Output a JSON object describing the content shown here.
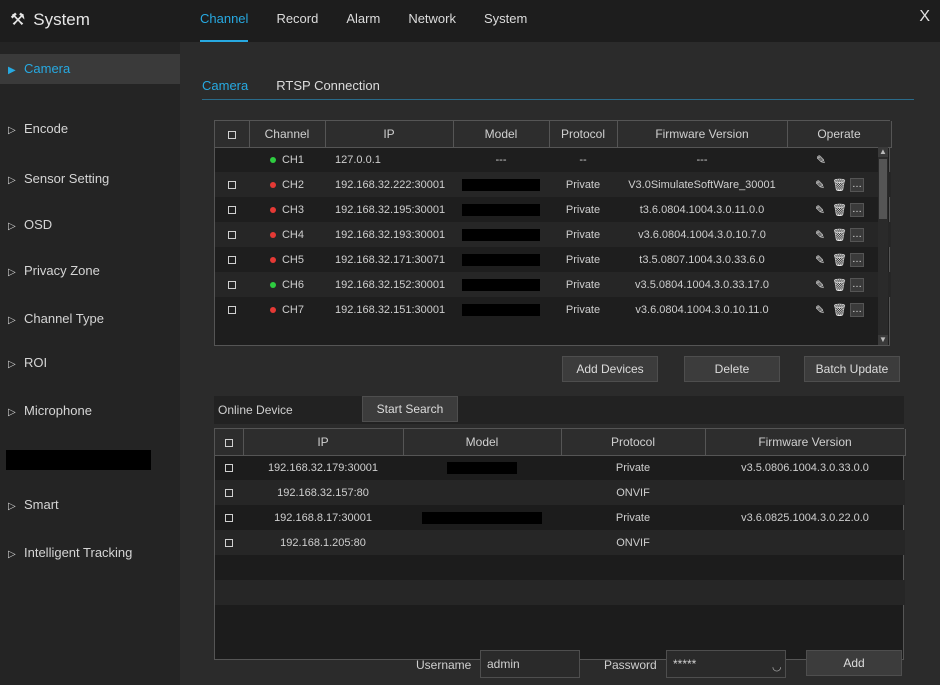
{
  "header": {
    "title": "System",
    "tool_icon": "tools-icon",
    "tabs": [
      "Channel",
      "Record",
      "Alarm",
      "Network",
      "System"
    ],
    "active_tab": "Channel",
    "close_glyph": "X"
  },
  "sidebar": {
    "items": [
      {
        "label": "Camera",
        "active": true
      },
      {
        "label": "Encode"
      },
      {
        "label": "Sensor Setting"
      },
      {
        "label": "OSD"
      },
      {
        "label": "Privacy Zone"
      },
      {
        "label": "Channel Type"
      },
      {
        "label": "ROI"
      },
      {
        "label": "Microphone"
      },
      {
        "label": "Smart"
      },
      {
        "label": "Intelligent Tracking"
      }
    ]
  },
  "subtabs": [
    "Camera",
    "RTSP Connection"
  ],
  "camera_table": {
    "headers": [
      "Channel",
      "IP",
      "Model",
      "Protocol",
      "Firmware Version",
      "Operate"
    ],
    "rows": [
      {
        "channel": "CH1",
        "status": "green",
        "ip": "127.0.0.1",
        "model": "---",
        "protocol": "--",
        "firmware": "---",
        "checkbox": false,
        "redacted": false
      },
      {
        "channel": "CH2",
        "status": "red",
        "ip": "192.168.32.222:30001",
        "model": "",
        "protocol": "Private",
        "firmware": "V3.0SimulateSoftWare_30001",
        "checkbox": true,
        "redacted": true
      },
      {
        "channel": "CH3",
        "status": "red",
        "ip": "192.168.32.195:30001",
        "model": "",
        "protocol": "Private",
        "firmware": "t3.6.0804.1004.3.0.11.0.0",
        "checkbox": true,
        "redacted": true
      },
      {
        "channel": "CH4",
        "status": "red",
        "ip": "192.168.32.193:30001",
        "model": "",
        "protocol": "Private",
        "firmware": "v3.6.0804.1004.3.0.10.7.0",
        "checkbox": true,
        "redacted": true
      },
      {
        "channel": "CH5",
        "status": "red",
        "ip": "192.168.32.171:30071",
        "model": "",
        "protocol": "Private",
        "firmware": "t3.5.0807.1004.3.0.33.6.0",
        "checkbox": true,
        "redacted": true
      },
      {
        "channel": "CH6",
        "status": "green",
        "ip": "192.168.32.152:30001",
        "model": "",
        "protocol": "Private",
        "firmware": "v3.5.0804.1004.3.0.33.17.0",
        "checkbox": true,
        "redacted": true
      },
      {
        "channel": "CH7",
        "status": "red",
        "ip": "192.168.32.151:30001",
        "model": "",
        "protocol": "Private",
        "firmware": "v3.6.0804.1004.3.0.10.11.0",
        "checkbox": true,
        "redacted": true
      }
    ],
    "op_icons": [
      "edit-icon",
      "trash-icon",
      "more-icon"
    ]
  },
  "buttons": {
    "add_devices": "Add Devices",
    "delete": "Delete",
    "batch_update": "Batch Update",
    "start_search": "Start Search",
    "add": "Add"
  },
  "online": {
    "label": "Online Device",
    "headers": [
      "IP",
      "Model",
      "Protocol",
      "Firmware Version"
    ],
    "rows": [
      {
        "ip": "192.168.32.179:30001",
        "model": "",
        "protocol": "Private",
        "firmware": "v3.5.0806.1004.3.0.33.0.0",
        "redacted": true
      },
      {
        "ip": "192.168.32.157:80",
        "model": "",
        "protocol": "ONVIF",
        "firmware": "",
        "redacted": false
      },
      {
        "ip": "192.168.8.17:30001",
        "model": "",
        "protocol": "Private",
        "firmware": "v3.6.0825.1004.3.0.22.0.0",
        "redacted": true
      },
      {
        "ip": "192.168.1.205:80",
        "model": "",
        "protocol": "ONVIF",
        "firmware": "",
        "redacted": false
      }
    ]
  },
  "login": {
    "username_label": "Username",
    "username_value": "admin",
    "password_label": "Password",
    "password_value": "*****"
  },
  "colors": {
    "accent": "#27a9e1",
    "online": "#2ecc40",
    "offline": "#e53935"
  }
}
